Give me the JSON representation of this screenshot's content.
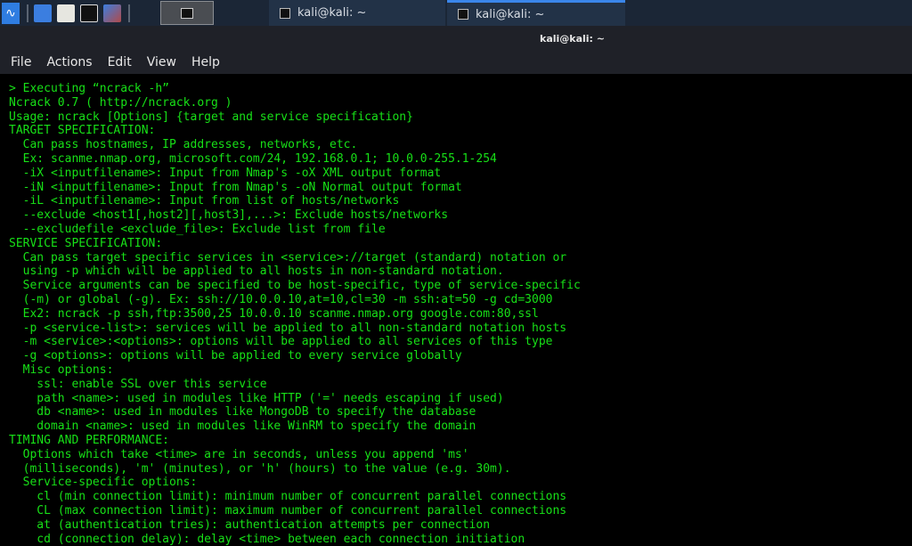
{
  "taskbar": {
    "launchers": [
      "kali-menu-icon",
      "desktop-icon",
      "file-manager-icon",
      "terminal-icon",
      "browser-icon"
    ],
    "tasks": [
      {
        "label": "kali@kali: ~"
      },
      {
        "label": "kali@kali: ~"
      }
    ]
  },
  "window": {
    "title": "kali@kali: ~"
  },
  "menu": [
    "File",
    "Actions",
    "Edit",
    "View",
    "Help"
  ],
  "terminal": {
    "color": "#17e017",
    "lines": [
      "> Executing “ncrack -h”",
      "Ncrack 0.7 ( http://ncrack.org )",
      "Usage: ncrack [Options] {target and service specification}",
      "TARGET SPECIFICATION:",
      "  Can pass hostnames, IP addresses, networks, etc.",
      "  Ex: scanme.nmap.org, microsoft.com/24, 192.168.0.1; 10.0.0-255.1-254",
      "  -iX <inputfilename>: Input from Nmap's -oX XML output format",
      "  -iN <inputfilename>: Input from Nmap's -oN Normal output format",
      "  -iL <inputfilename>: Input from list of hosts/networks",
      "  --exclude <host1[,host2][,host3],...>: Exclude hosts/networks",
      "  --excludefile <exclude_file>: Exclude list from file",
      "SERVICE SPECIFICATION:",
      "  Can pass target specific services in <service>://target (standard) notation or",
      "  using -p which will be applied to all hosts in non-standard notation.",
      "  Service arguments can be specified to be host-specific, type of service-specific",
      "  (-m) or global (-g). Ex: ssh://10.0.0.10,at=10,cl=30 -m ssh:at=50 -g cd=3000",
      "  Ex2: ncrack -p ssh,ftp:3500,25 10.0.0.10 scanme.nmap.org google.com:80,ssl",
      "  -p <service-list>: services will be applied to all non-standard notation hosts",
      "  -m <service>:<options>: options will be applied to all services of this type",
      "  -g <options>: options will be applied to every service globally",
      "  Misc options:",
      "    ssl: enable SSL over this service",
      "    path <name>: used in modules like HTTP ('=' needs escaping if used)",
      "    db <name>: used in modules like MongoDB to specify the database",
      "    domain <name>: used in modules like WinRM to specify the domain",
      "TIMING AND PERFORMANCE:",
      "  Options which take <time> are in seconds, unless you append 'ms'",
      "  (milliseconds), 'm' (minutes), or 'h' (hours) to the value (e.g. 30m).",
      "  Service-specific options:",
      "    cl (min connection limit): minimum number of concurrent parallel connections",
      "    CL (max connection limit): maximum number of concurrent parallel connections",
      "    at (authentication tries): authentication attempts per connection",
      "    cd (connection delay): delay <time> between each connection initiation"
    ]
  }
}
